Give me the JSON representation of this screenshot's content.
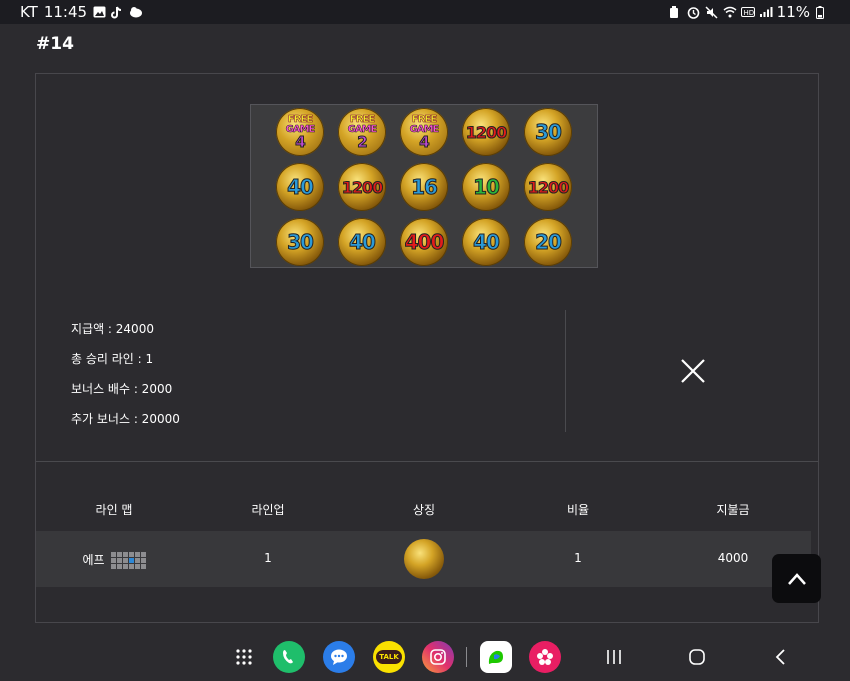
{
  "status_bar": {
    "carrier": "KT",
    "time": "11:45",
    "battery": "11%"
  },
  "page": {
    "title": "#14"
  },
  "reels": [
    [
      {
        "type": "free",
        "t1": "FREE",
        "t2": "GAME",
        "n": "4"
      },
      {
        "type": "free",
        "t1": "FREE",
        "t2": "GAME",
        "n": "2"
      },
      {
        "type": "free",
        "t1": "FREE",
        "t2": "GAME",
        "n": "4"
      },
      {
        "type": "num",
        "v": "1200",
        "c": "red"
      },
      {
        "type": "num",
        "v": "30",
        "c": "blue"
      }
    ],
    [
      {
        "type": "num",
        "v": "40",
        "c": "blue"
      },
      {
        "type": "num",
        "v": "1200",
        "c": "red"
      },
      {
        "type": "num",
        "v": "16",
        "c": "blue"
      },
      {
        "type": "num",
        "v": "10",
        "c": "green"
      },
      {
        "type": "num",
        "v": "1200",
        "c": "red"
      }
    ],
    [
      {
        "type": "num",
        "v": "30",
        "c": "blue"
      },
      {
        "type": "num",
        "v": "40",
        "c": "blue"
      },
      {
        "type": "num",
        "v": "400",
        "c": "red"
      },
      {
        "type": "num",
        "v": "40",
        "c": "blue"
      },
      {
        "type": "num",
        "v": "20",
        "c": "blue"
      }
    ]
  ],
  "info": {
    "payout": "지급액 : 24000",
    "win_lines": "총 승리 라인 : 1",
    "bonus_multiplier": "보너스 배수 : 2000",
    "extra_bonus": "추가 보너스 : 20000"
  },
  "table": {
    "headers": [
      "라인 맵",
      "라인업",
      "상징",
      "비율",
      "지불금"
    ],
    "row": {
      "line_map_label": "에프",
      "lineup": "1",
      "ratio": "1",
      "payout": "4000",
      "grid_on_index": 9
    }
  },
  "navbar": {
    "talk_label": "TALK"
  },
  "colors": {
    "accent_blue": "#2e88d6",
    "background": "#2c2b2f"
  }
}
